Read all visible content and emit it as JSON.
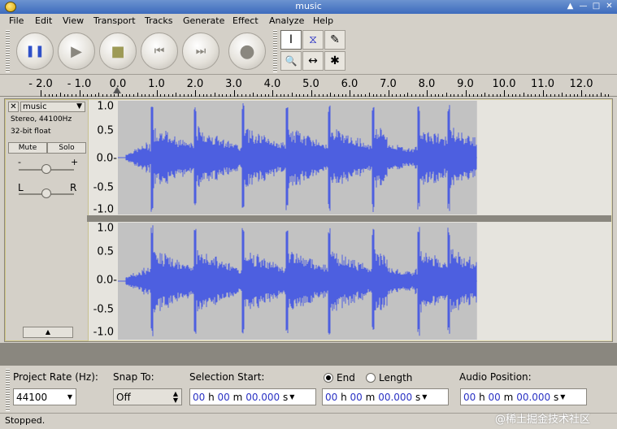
{
  "window": {
    "title": "music"
  },
  "menu": [
    "File",
    "Edit",
    "View",
    "Transport",
    "Tracks",
    "Generate",
    "Effect",
    "Analyze",
    "Help"
  ],
  "transport": {
    "pause": "❚❚",
    "play": "▶",
    "stop": "■",
    "skip_start": "⏮",
    "skip_end": "⏭",
    "record": "●"
  },
  "tools": {
    "select": "I",
    "envelope": "⧖",
    "draw": "✎",
    "zoom": "🔍",
    "timeshift": "↔",
    "multi": "✱"
  },
  "ruler": {
    "labels": [
      "- 2.0",
      "- 1.0",
      "0.0",
      "1.0",
      "2.0",
      "3.0",
      "4.0",
      "5.0",
      "6.0",
      "7.0",
      "8.0",
      "9.0",
      "10.0",
      "11.0",
      "12.0"
    ],
    "values": [
      -2,
      -1,
      0,
      1,
      2,
      3,
      4,
      5,
      6,
      7,
      8,
      9,
      10,
      11,
      12
    ]
  },
  "track": {
    "name": "music",
    "format": "Stereo, 44100Hz",
    "bitdepth": "32-bit float",
    "mute": "Mute",
    "solo": "Solo",
    "gain_minus": "-",
    "gain_plus": "+",
    "pan_left": "L",
    "pan_right": "R",
    "duration_seconds": 9.3,
    "channel_scale": [
      "1.0",
      "0.5",
      "0.0-",
      "-0.5",
      "-1.0"
    ],
    "colors": {
      "wave": "#4d5fe0",
      "wave_fill": "#c2c2c2",
      "empty": "#e6e4de"
    }
  },
  "bottom": {
    "project_rate_label": "Project Rate (Hz):",
    "project_rate_value": "44100",
    "snap_label": "Snap To:",
    "snap_value": "Off",
    "selection_start_label": "Selection Start:",
    "end_label": "End",
    "length_label": "Length",
    "audio_position_label": "Audio Position:",
    "time_h": "00",
    "time_m": "00",
    "time_s": "00.000",
    "unit_h": "h",
    "unit_m": "m",
    "unit_s": "s"
  },
  "status": {
    "text": "Stopped."
  },
  "watermark": "@稀土掘金技术社区"
}
